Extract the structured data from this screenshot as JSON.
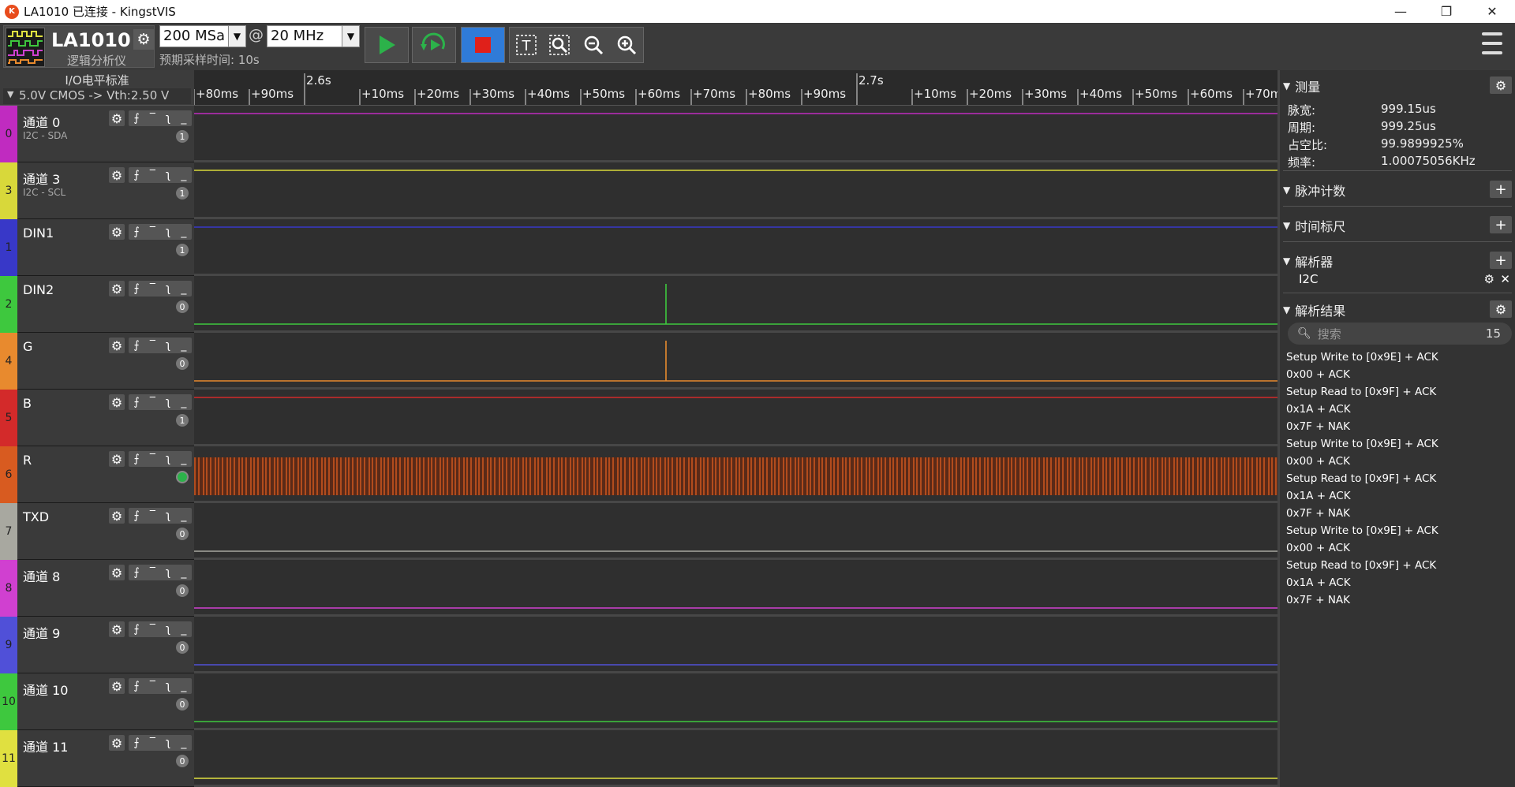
{
  "window": {
    "title": "LA1010 已连接 - KingstVIS",
    "app_icon": "kingst-logo-icon",
    "controls": [
      "minimize",
      "restore",
      "close"
    ]
  },
  "toolbar": {
    "device_name": "LA1010",
    "device_subtitle": "逻辑分析仪",
    "sample_depth": "200 MSa",
    "sample_rate": "20 MHz",
    "at_sign": "@",
    "expected_time": "预期采样时间: 10s",
    "colors": {
      "start": "#2cb24a",
      "stop": "#e0201a",
      "stop_bg": "#2f7bd8"
    }
  },
  "io_standard": {
    "label": "I/O电平标准",
    "value": "5.0V CMOS -> Vth:2.50 V"
  },
  "channels": [
    {
      "index": "0",
      "name": "通道 0",
      "sub": "I2C - SDA",
      "badge": "1",
      "color": "#c02bc0",
      "wave": "#c02bc0"
    },
    {
      "index": "3",
      "name": "通道 3",
      "sub": "I2C - SCL",
      "badge": "1",
      "color": "#d8d83a",
      "wave": "#d8d83a"
    },
    {
      "index": "1",
      "name": "DIN1",
      "sub": "",
      "badge": "1",
      "color": "#3838c8",
      "wave": "#3838c8"
    },
    {
      "index": "2",
      "name": "DIN2",
      "sub": "",
      "badge": "0",
      "color": "#3ec83e",
      "wave": "#3ec83e"
    },
    {
      "index": "4",
      "name": "G",
      "sub": "",
      "badge": "0",
      "color": "#e88a2e",
      "wave": "#e88a2e"
    },
    {
      "index": "5",
      "name": "B",
      "sub": "",
      "badge": "1",
      "color": "#d32a2a",
      "wave": "#d32a2a"
    },
    {
      "index": "6",
      "name": "R",
      "sub": "",
      "badge": "",
      "color": "#d85b20",
      "wave": "#d85b20"
    },
    {
      "index": "7",
      "name": "TXD",
      "sub": "",
      "badge": "0",
      "color": "#a8a8a0",
      "wave": "#a8a8a0"
    },
    {
      "index": "8",
      "name": "通道 8",
      "sub": "",
      "badge": "0",
      "color": "#d040d0",
      "wave": "#d040d0"
    },
    {
      "index": "9",
      "name": "通道 9",
      "sub": "",
      "badge": "0",
      "color": "#5050d8",
      "wave": "#5050d8"
    },
    {
      "index": "10",
      "name": "通道 10",
      "sub": "",
      "badge": "0",
      "color": "#3ec83e",
      "wave": "#3ec83e"
    },
    {
      "index": "11",
      "name": "通道 11",
      "sub": "",
      "badge": "0",
      "color": "#e0e040",
      "wave": "#e0e040"
    }
  ],
  "ruler": {
    "labels_row1": [
      "+80ms",
      "+90ms",
      "2.6s",
      "+10ms",
      "+20ms",
      "+30ms",
      "+40ms",
      "+50ms",
      "+60ms",
      "+70ms",
      "+80ms",
      "+90ms",
      "2.7s",
      "+10ms",
      "+20ms",
      "+30ms",
      "+40ms",
      "+50ms",
      "+60ms",
      "+70m"
    ]
  },
  "measure": {
    "title": "测量",
    "rows": [
      {
        "label": "脉宽:",
        "value": "999.15us"
      },
      {
        "label": "周期:",
        "value": "999.25us"
      },
      {
        "label": "占空比:",
        "value": "99.9899925%"
      },
      {
        "label": "频率:",
        "value": "1.00075056KHz"
      }
    ]
  },
  "pulse_count": {
    "title": "脉冲计数"
  },
  "time_ruler": {
    "title": "时间标尺"
  },
  "analyzer": {
    "title": "解析器",
    "item": "I2C"
  },
  "results": {
    "title": "解析结果",
    "search_placeholder": "搜索",
    "count": "15",
    "items": [
      "Setup Write to [0x9E] + ACK",
      "0x00 + ACK",
      "Setup Read to [0x9F] + ACK",
      "0x1A + ACK",
      "0x7F + NAK",
      "Setup Write to [0x9E] + ACK",
      "0x00 + ACK",
      "Setup Read to [0x9F] + ACK",
      "0x1A + ACK",
      "0x7F + NAK",
      "Setup Write to [0x9E] + ACK",
      "0x00 + ACK",
      "Setup Read to [0x9F] + ACK",
      "0x1A + ACK",
      "0x7F + NAK"
    ]
  }
}
